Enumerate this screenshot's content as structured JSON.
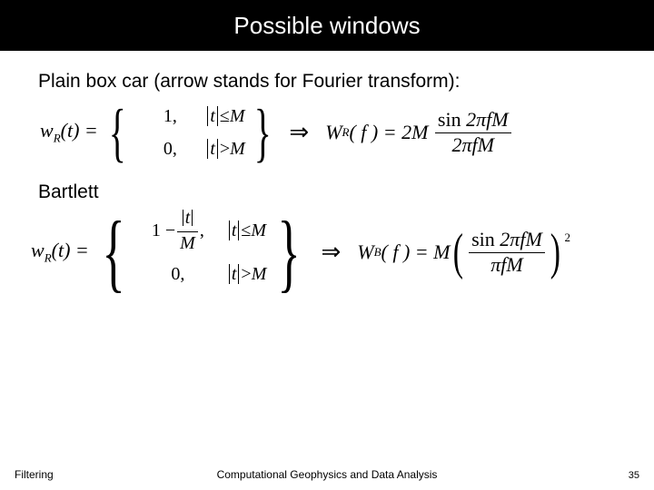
{
  "title": "Possible windows",
  "intro1": "Plain box car (arrow stands for Fourier transform):",
  "intro2": "Bartlett",
  "eq1": {
    "lhs_func": "w",
    "lhs_sub": "R",
    "lhs_arg": "(t) =",
    "case1_val": "1,",
    "case1_cond_var": "t",
    "case1_cond_rel": " ≤ ",
    "case1_cond_rhs": "M",
    "case2_val": "0,",
    "case2_cond_var": "t",
    "case2_cond_rel": " > ",
    "case2_cond_rhs": "M",
    "arrow": "⇒",
    "rhs_func": "W",
    "rhs_sub": "R",
    "rhs_arg": "( f ) = 2M",
    "frac_num": "sin 2πfM",
    "frac_den": "2πfM"
  },
  "eq2": {
    "lhs_func": "w",
    "lhs_sub": "R",
    "lhs_arg": "(t) =",
    "case1_pre": "1 − ",
    "case1_num_var": "t",
    "case1_den": "M",
    "case1_post": ",",
    "case1_cond_var": "t",
    "case1_cond_rel": " ≤ ",
    "case1_cond_rhs": "M",
    "case2_val": "0,",
    "case2_cond_var": "t",
    "case2_cond_rel": " > ",
    "case2_cond_rhs": "M",
    "arrow": "⇒",
    "rhs_func": "W",
    "rhs_sub": "B",
    "rhs_arg": "( f ) = M",
    "frac_num": "sin 2πfM",
    "frac_den": "πfM",
    "power": "2"
  },
  "footer": {
    "left": "Filtering",
    "center": "Computational Geophysics and Data Analysis",
    "page": "35"
  }
}
